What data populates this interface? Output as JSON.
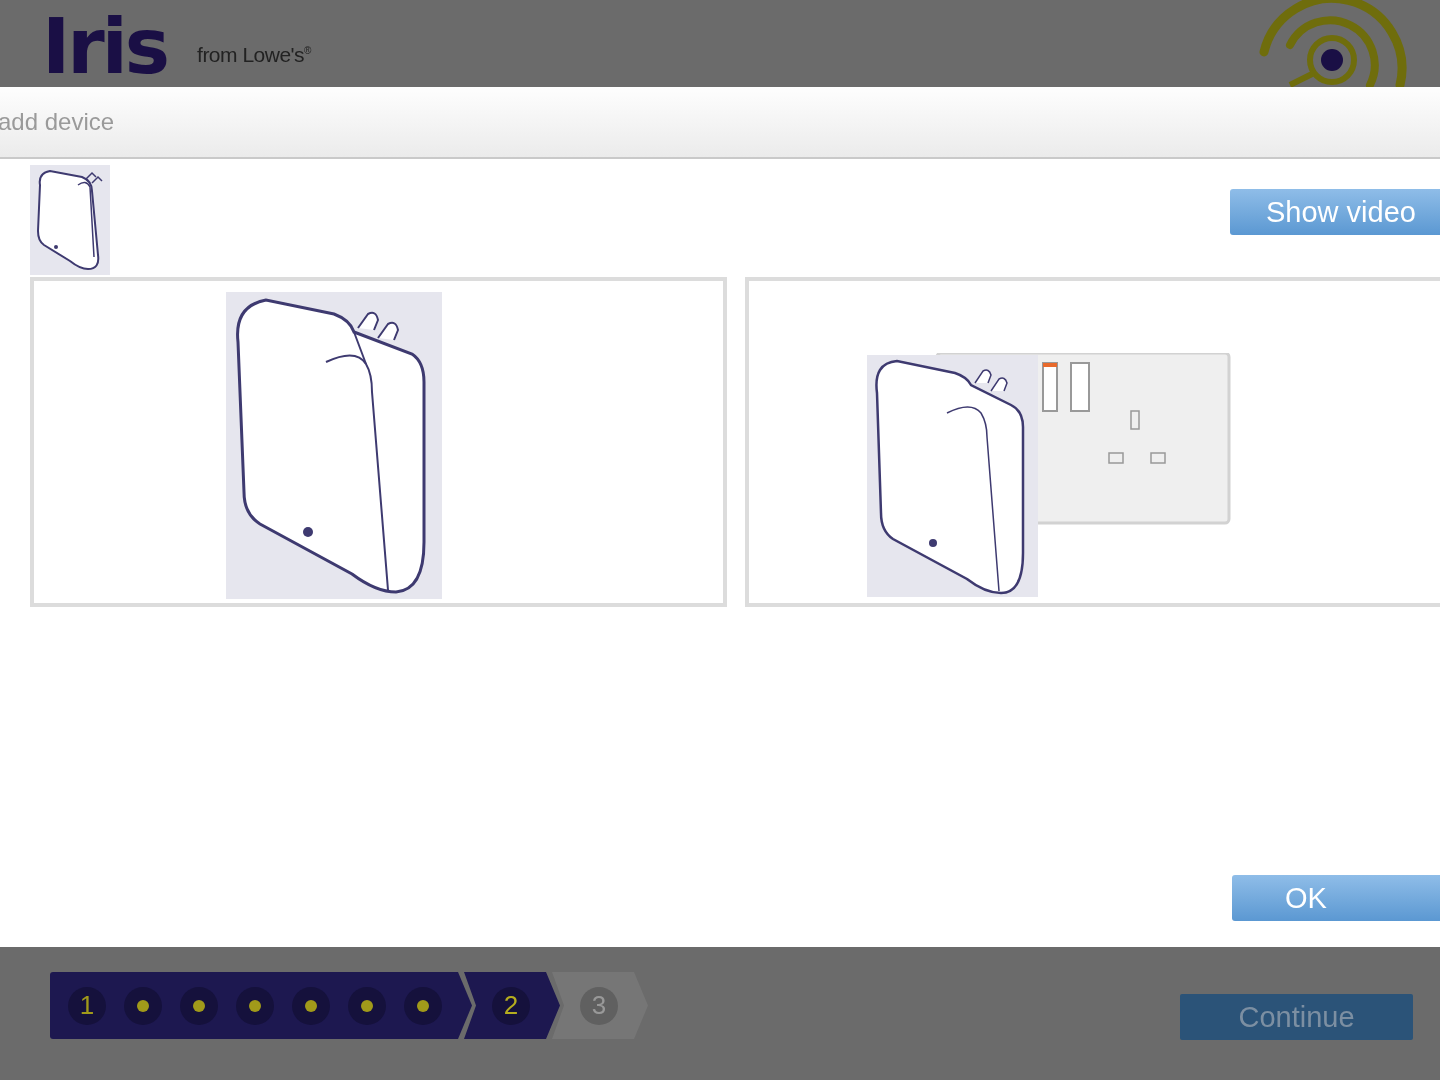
{
  "header": {
    "logo": "Iris",
    "tagline": "from Lowe's",
    "tagline_mark": "®"
  },
  "dialog": {
    "title": "add device",
    "video_button": "Show video",
    "ok_button": "OK",
    "panels": [
      {
        "kind": "device"
      },
      {
        "kind": "device-in-outlet"
      }
    ]
  },
  "progress": {
    "steps": [
      {
        "label": "1",
        "completed": true,
        "selected": false,
        "substeps": [
          {
            "done": true
          },
          {
            "done": true
          },
          {
            "done": true
          },
          {
            "done": true
          },
          {
            "done": true
          },
          {
            "done": true
          }
        ]
      },
      {
        "label": "2",
        "completed": false,
        "selected": true
      },
      {
        "label": "3",
        "completed": false,
        "selected": false
      }
    ]
  },
  "continue_button": {
    "label": "Continue",
    "disabled": true
  }
}
